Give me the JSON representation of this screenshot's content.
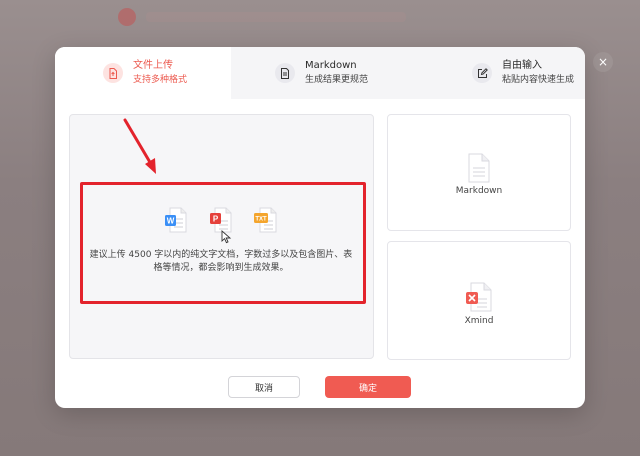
{
  "tabs": [
    {
      "title": "文件上传",
      "subtitle": "支持多种格式",
      "icon": "file-upload-icon",
      "active": true
    },
    {
      "title": "Markdown",
      "subtitle": "生成结果更规范",
      "icon": "document-icon",
      "active": false
    },
    {
      "title": "自由输入",
      "subtitle": "粘贴内容快速生成",
      "icon": "edit-icon",
      "active": false
    }
  ],
  "close_icon": "×",
  "upload": {
    "file_types": [
      {
        "icon": "word-file-icon",
        "badge": "W",
        "color": "#3a8ff6"
      },
      {
        "icon": "pdf-file-icon",
        "badge": "P",
        "color": "#e5413b"
      },
      {
        "icon": "txt-file-icon",
        "badge": "TXT",
        "color": "#f4a52d"
      }
    ],
    "hint": "建议上传 4500 字以内的纯文字文档，字数过多以及包含图片、表格等情况，都会影响到生成效果。"
  },
  "cards": {
    "markdown_label": "Markdown",
    "xmind_label": "Xmind"
  },
  "buttons": {
    "cancel": "取消",
    "confirm": "确定"
  },
  "colors": {
    "accent": "#f05b52",
    "highlight": "#e3232c"
  }
}
